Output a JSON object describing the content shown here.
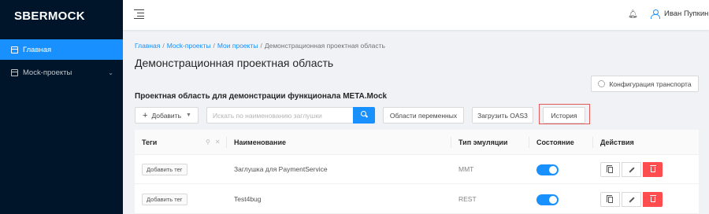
{
  "app": {
    "logo": "SBERMOCK"
  },
  "sidebar": {
    "items": [
      {
        "label": "Главная"
      },
      {
        "label": "Mock-проекты"
      }
    ]
  },
  "header": {
    "user_name": "Иван Пупкин"
  },
  "breadcrumb": {
    "items": [
      "Главная",
      "Mock-проекты",
      "Мои проекты",
      "Демонстрационная проектная область"
    ]
  },
  "page": {
    "title": "Демонстрационная проектная область",
    "section_title": "Проектная область для демонстрации функционала META.Mock"
  },
  "toolbar": {
    "transport_label": "Конфигурация транспорта",
    "add_label": "Добавить",
    "search_placeholder": "Искать по наименованию заглушки",
    "vars_label": "Области переменных",
    "oas_label": "Загрузить OAS3",
    "history_label": "История"
  },
  "table": {
    "columns": [
      "Теги",
      "Наименование",
      "Тип эмуляции",
      "Состояние",
      "Действия"
    ],
    "rows": [
      {
        "tag_button": "Добавить тег",
        "name": "Заглушка для PaymentService",
        "emulation": "MMT",
        "enabled": true
      },
      {
        "tag_button": "Добавить тег",
        "name": "Test4bug",
        "emulation": "REST",
        "enabled": true
      }
    ]
  },
  "colors": {
    "accent": "#1890ff",
    "sidebar_bg": "#001529",
    "danger": "#ff4d4f"
  }
}
